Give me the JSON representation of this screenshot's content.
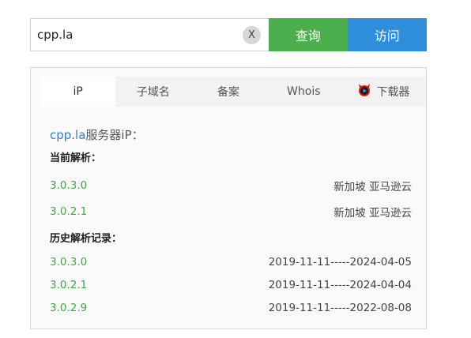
{
  "search": {
    "value": "cpp.la",
    "clear_label": "X"
  },
  "buttons": {
    "query": "查询",
    "visit": "访问"
  },
  "tabs": [
    {
      "label": "iP"
    },
    {
      "label": "子域名"
    },
    {
      "label": "备案"
    },
    {
      "label": "Whois"
    },
    {
      "label": "下载器"
    }
  ],
  "result": {
    "domain": "cpp.la",
    "title_suffix": "服务器iP：",
    "current_label": "当前解析：",
    "current": [
      {
        "ip": "3.0.3.0",
        "location": "新加坡 亚马逊云"
      },
      {
        "ip": "3.0.2.1",
        "location": "新加坡 亚马逊云"
      }
    ],
    "history_label": "历史解析记录：",
    "history": [
      {
        "ip": "3.0.3.0",
        "range": "2019-11-11-----2024-04-05"
      },
      {
        "ip": "3.0.2.1",
        "range": "2019-11-11-----2024-04-04"
      },
      {
        "ip": "3.0.2.9",
        "range": "2019-11-11-----2022-08-08"
      }
    ]
  },
  "colors": {
    "query_btn": "#4cae4c",
    "visit_btn": "#2e8ed9",
    "ip_text": "#3daa3d",
    "domain_text": "#2f7fc1"
  }
}
